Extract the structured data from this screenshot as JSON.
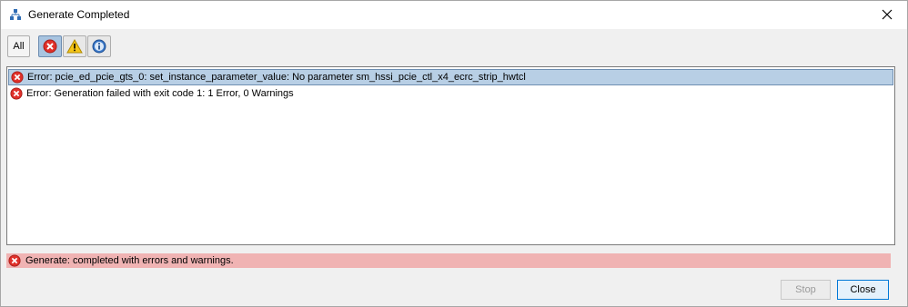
{
  "window": {
    "title": "Generate Completed",
    "icon": "network-tree-icon"
  },
  "toolbar": {
    "all_label": "All",
    "filters": [
      {
        "name": "error-filter",
        "icon": "error-icon",
        "active": true
      },
      {
        "name": "warning-filter",
        "icon": "warning-icon",
        "active": false
      },
      {
        "name": "info-filter",
        "icon": "info-icon",
        "active": false
      }
    ]
  },
  "messages": [
    {
      "severity": "error",
      "text": "Error: pcie_ed_pcie_gts_0: set_instance_parameter_value: No parameter sm_hssi_pcie_ctl_x4_ecrc_strip_hwtcl",
      "selected": true
    },
    {
      "severity": "error",
      "text": "Error: Generation failed with exit code 1: 1 Error, 0 Warnings",
      "selected": false
    }
  ],
  "status": {
    "severity": "error",
    "text": "Generate: completed with errors and warnings."
  },
  "buttons": {
    "stop_label": "Stop",
    "close_label": "Close"
  },
  "colors": {
    "selection": "#b8cfe5",
    "status_error_bg": "#f0b3b3",
    "error_red": "#e0302a",
    "warning_yellow": "#f5c518",
    "info_blue": "#3a78c9"
  }
}
